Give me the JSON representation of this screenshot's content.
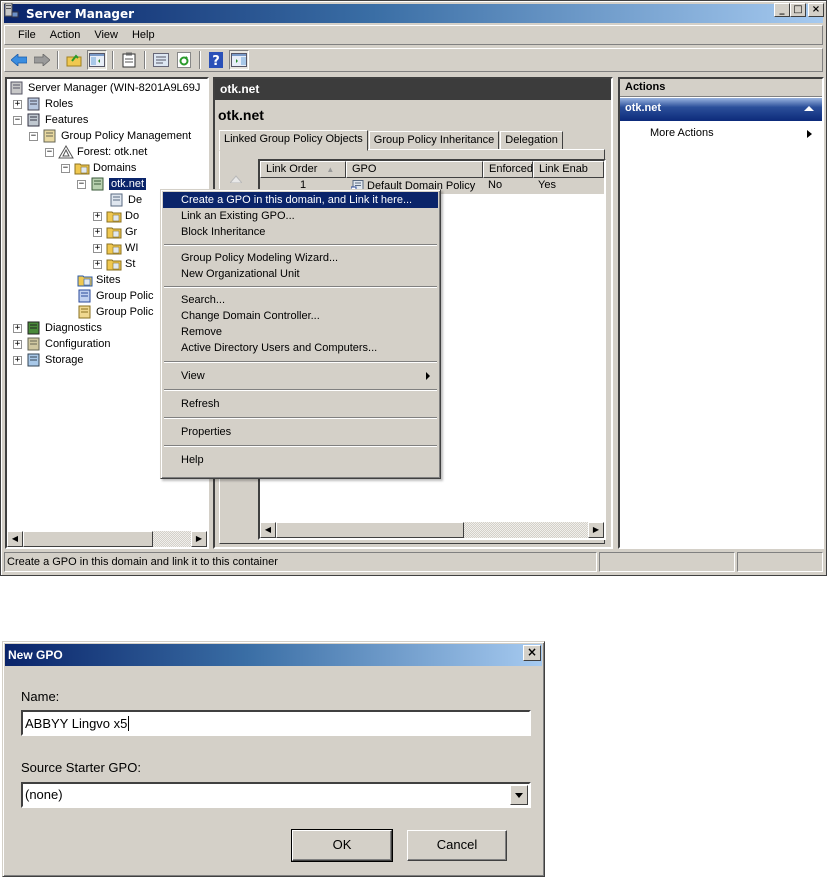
{
  "window": {
    "title": "Server Manager",
    "controls": {
      "minimize": "_",
      "maximize": "□",
      "close": "×"
    }
  },
  "menubar": {
    "items": [
      "File",
      "Action",
      "View",
      "Help"
    ]
  },
  "toolbar": {
    "buttons": [
      "back-icon",
      "forward-icon",
      "up-folder-icon",
      "show-hide-console-tree-icon",
      "clipboard-icon",
      "properties-icon",
      "refresh-icon",
      "help-icon",
      "show-hide-action-pane-icon"
    ]
  },
  "tree": {
    "items": [
      {
        "label": "Server Manager (WIN-8201A9L69J",
        "expander": "",
        "icon": "server-icon"
      },
      {
        "label": "Roles",
        "expander": "+",
        "icon": "roles-icon"
      },
      {
        "label": "Features",
        "expander": "−",
        "icon": "features-icon"
      },
      {
        "label": "Group Policy Management",
        "expander": "−",
        "icon": "gpm-icon"
      },
      {
        "label": "Forest: otk.net",
        "expander": "−",
        "icon": "forest-icon"
      },
      {
        "label": "Domains",
        "expander": "−",
        "icon": "domains-folder-icon"
      },
      {
        "label": "otk.net",
        "expander": "−",
        "icon": "domain-icon",
        "selected": true
      },
      {
        "label": "De",
        "expander": "",
        "icon": "gpo-link-icon"
      },
      {
        "label": "Do",
        "expander": "+",
        "icon": "ou-folder-icon"
      },
      {
        "label": "Gr",
        "expander": "+",
        "icon": "gpo-folder-icon"
      },
      {
        "label": "WI",
        "expander": "+",
        "icon": "wmi-folder-icon"
      },
      {
        "label": "St",
        "expander": "+",
        "icon": "starter-folder-icon"
      },
      {
        "label": "Sites",
        "expander": "",
        "icon": "sites-folder-icon"
      },
      {
        "label": "Group Polic",
        "expander": "",
        "icon": "modeling-icon"
      },
      {
        "label": "Group Polic",
        "expander": "",
        "icon": "results-icon"
      },
      {
        "label": "Diagnostics",
        "expander": "+",
        "icon": "diagnostics-icon"
      },
      {
        "label": "Configuration",
        "expander": "+",
        "icon": "configuration-icon"
      },
      {
        "label": "Storage",
        "expander": "+",
        "icon": "storage-icon"
      }
    ]
  },
  "center": {
    "header": "otk.net",
    "title": "otk.net",
    "tabs": [
      "Linked Group Policy Objects",
      "Group Policy Inheritance",
      "Delegation"
    ],
    "active_tab": 0,
    "table": {
      "columns": [
        "Link Order",
        "GPO",
        "Enforced",
        "Link Enab"
      ],
      "sort_indicator": "▲",
      "rows": [
        {
          "link_order": "1",
          "gpo": "Default Domain Policy",
          "enforced": "No",
          "link_enabled": "Yes"
        }
      ]
    }
  },
  "actions": {
    "title": "Actions",
    "section": "otk.net",
    "items": [
      "More Actions"
    ]
  },
  "status": {
    "text": "Create a GPO in this domain and link it to this container"
  },
  "context_menu": {
    "groups": [
      [
        "Create a GPO in this domain, and Link it here...",
        "Link an Existing GPO...",
        "Block Inheritance"
      ],
      [
        "Group Policy Modeling Wizard...",
        "New Organizational Unit"
      ],
      [
        "Search...",
        "Change Domain Controller...",
        "Remove",
        "Active Directory Users and Computers..."
      ],
      [
        "View"
      ],
      [
        "Refresh"
      ],
      [
        "Properties"
      ],
      [
        "Help"
      ]
    ],
    "highlighted": "Create a GPO in this domain, and Link it here...",
    "submenu_items": [
      "View"
    ]
  },
  "dialog": {
    "title": "New GPO",
    "name_label": "Name:",
    "name_value": "ABBYY Lingvo x5",
    "source_label": "Source Starter GPO:",
    "source_value": "(none)",
    "ok_label": "OK",
    "cancel_label": "Cancel",
    "close": "×"
  },
  "colors": {
    "title_gradient_start": "#0a246a",
    "title_gradient_end": "#a6caf0",
    "chrome": "#d4d0c8",
    "selection": "#0a246a",
    "pane_header_dark": "#3c3c3c"
  }
}
